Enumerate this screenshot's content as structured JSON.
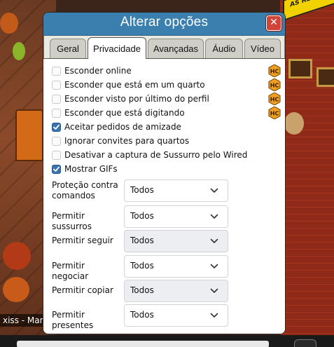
{
  "dialog": {
    "title": "Alterar opções",
    "close_glyph": "✕"
  },
  "tabs": [
    {
      "label": "Geral",
      "active": false
    },
    {
      "label": "Privacidade",
      "active": true
    },
    {
      "label": "Avançadas",
      "active": false
    },
    {
      "label": "Áudio",
      "active": false
    },
    {
      "label": "Vídeo",
      "active": false
    }
  ],
  "checkboxes": [
    {
      "label": "Esconder online",
      "checked": false,
      "hc_badge": true
    },
    {
      "label": "Esconder que está em um quarto",
      "checked": false,
      "hc_badge": true
    },
    {
      "label": "Esconder visto por último do perfil",
      "checked": false,
      "hc_badge": true
    },
    {
      "label": "Esconder que está digitando",
      "checked": false,
      "hc_badge": true
    },
    {
      "label": "Aceitar pedidos de amizade",
      "checked": true,
      "hc_badge": false
    },
    {
      "label": "Ignorar convites para quartos",
      "checked": false,
      "hc_badge": false
    },
    {
      "label": "Desativar a captura de Sussurro pelo Wired",
      "checked": false,
      "hc_badge": false
    },
    {
      "label": "Mostrar GIFs",
      "checked": true,
      "hc_badge": false
    }
  ],
  "selects": [
    {
      "label": "Proteção contra comandos",
      "value": "Todos"
    },
    {
      "label": "Permitir sussurros",
      "value": "Todos"
    },
    {
      "label": "Permitir seguir",
      "value": "Todos"
    },
    {
      "label": "Permitir negociar",
      "value": "Todos"
    },
    {
      "label": "Permitir copiar",
      "value": "Todos"
    },
    {
      "label": "Permitir presentes",
      "value": "Todos"
    }
  ],
  "background": {
    "username_text": "xiss - Mande",
    "banner_text": "AS REDES!"
  },
  "colors": {
    "titlebar": "#3a7fae",
    "checkbox_on": "#3a72b0",
    "close_button": "#d0443a",
    "hc_badge": "#f0a020"
  },
  "icons": {
    "close": "close-icon",
    "checkmark": "checkmark-icon",
    "chevron": "chevron-down-icon",
    "hc_badge": "hc-badge-icon"
  }
}
